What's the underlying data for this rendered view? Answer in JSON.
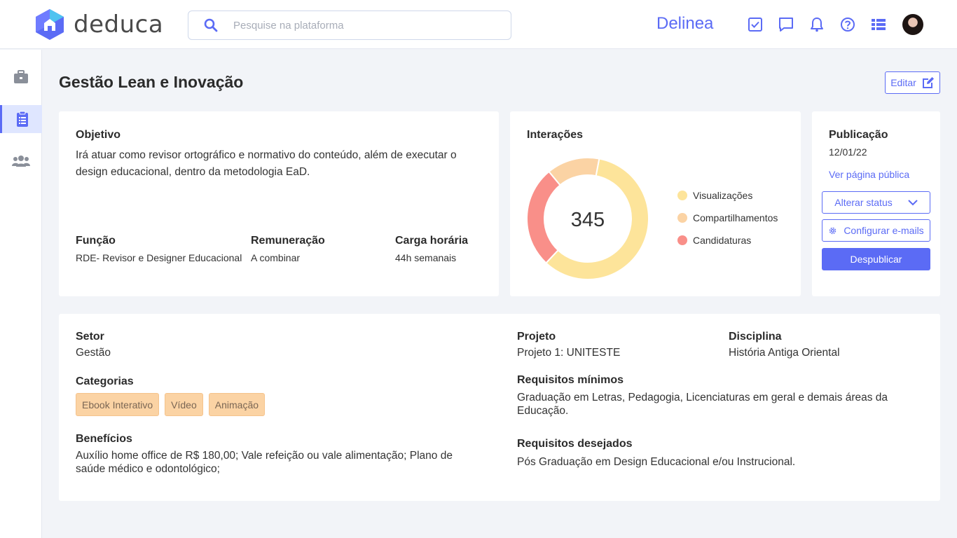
{
  "app": {
    "logo_text": "deduca",
    "brand": "Delinea"
  },
  "search": {
    "placeholder": "Pesquise na plataforma"
  },
  "topbar_icons": [
    "checkbox-icon",
    "chat-icon",
    "bell-icon",
    "help-icon",
    "list-icon"
  ],
  "sidebar": {
    "items": [
      "briefcase-icon",
      "clipboard-icon",
      "users-icon"
    ],
    "active_index": 1
  },
  "page": {
    "title": "Gestão Lean e Inovação",
    "edit_label": "Editar"
  },
  "objective": {
    "label": "Objetivo",
    "text": "Irá atuar como revisor ortográfico e normativo do conteúdo, além de executar o design educacional, dentro da metodologia EaD.",
    "funcao_label": "Função",
    "funcao_value": "RDE- Revisor e Designer Educacional",
    "remuneracao_label": "Remuneração",
    "remuneracao_value": "A combinar",
    "carga_label": "Carga horária",
    "carga_value": "44h semanais"
  },
  "interactions": {
    "label": "Interações",
    "total": "345"
  },
  "chart_data": {
    "type": "pie",
    "donut": true,
    "center_text": "345",
    "series": [
      {
        "name": "Visualizações",
        "fraction": 0.59,
        "color": "#fde49a"
      },
      {
        "name": "Compartilhamentos",
        "fraction": 0.14,
        "color": "#fbd3a4"
      },
      {
        "name": "Candidaturas",
        "fraction": 0.27,
        "color": "#f98f89"
      }
    ]
  },
  "publication": {
    "label": "Publicação",
    "date": "12/01/22",
    "public_link": "Ver página pública",
    "status_btn": "Alterar status",
    "config_btn": "Configurar e-mails",
    "unpublish_btn": "Despublicar"
  },
  "details": {
    "setor_label": "Setor",
    "setor_value": "Gestão",
    "categorias_label": "Categorias",
    "categorias": [
      "Ebook Interativo",
      "Vídeo",
      "Animação"
    ],
    "beneficios_label": "Benefícios",
    "beneficios_value": "Auxílio home office de R$ 180,00;  Vale refeição ou vale alimentação; Plano de saúde médico e odontológico;",
    "projeto_label": "Projeto",
    "projeto_value": "Projeto 1: UNITESTE",
    "disciplina_label": "Disciplina",
    "disciplina_value": "História Antiga Oriental",
    "req_min_label": "Requisitos mínimos",
    "req_min_value": "Graduação em Letras, Pedagogia, Licenciaturas em geral e demais áreas da Educação.",
    "req_des_label": "Requisitos desejados",
    "req_des_value": "Pós Graduação em Design Educacional e/ou Instrucional."
  },
  "colors": {
    "accent": "#5b6bf5",
    "tag_bg": "#fbd3a4"
  }
}
